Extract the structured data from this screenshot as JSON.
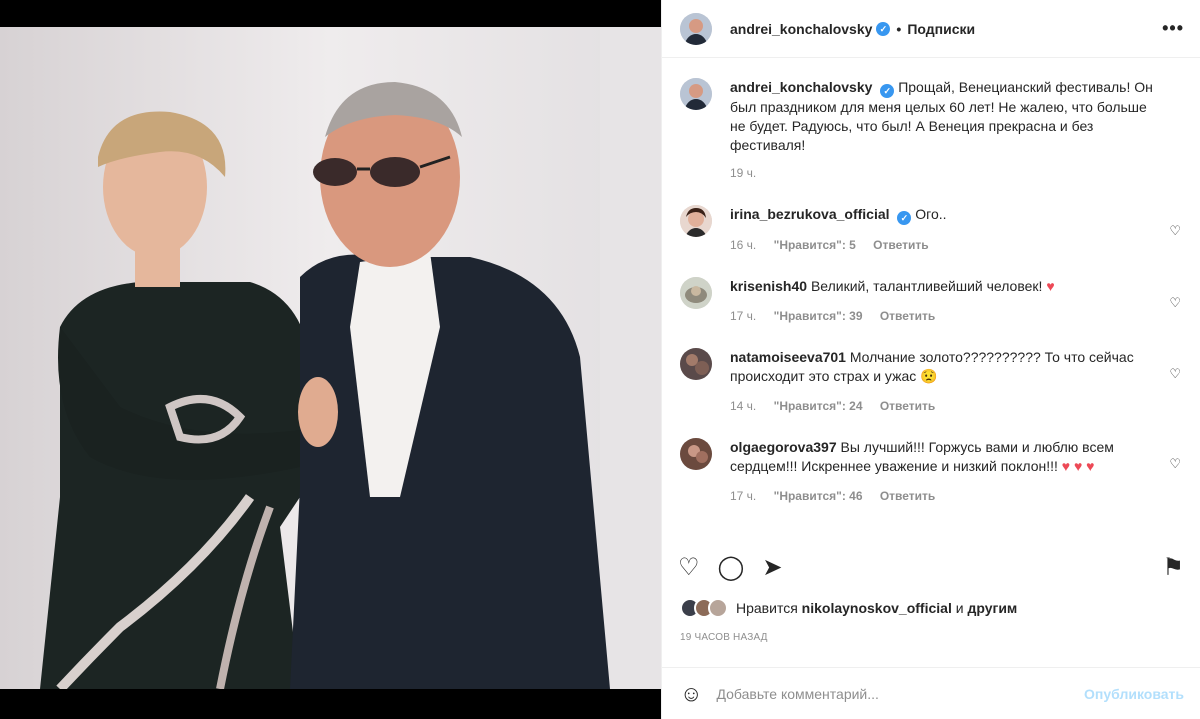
{
  "post": {
    "author": "andrei_konchalovsky",
    "follow_label": "Подписки",
    "dot": "•",
    "more": "•••"
  },
  "caption": {
    "author": "andrei_konchalovsky",
    "text": "Прощай, Венецианский фестиваль! Он был праздником для меня целых 60 лет! Не жалею, что больше не будет. Радуюсь, что был! А Венеция прекрасна и без фестиваля!",
    "time": "19 ч."
  },
  "comments": [
    {
      "user": "irina_bezrukova_official",
      "verified": true,
      "text": "Ого..",
      "emoji": "",
      "time": "16 ч.",
      "likes": "\"Нравится\": 5",
      "reply": "Ответить"
    },
    {
      "user": "krisenish40",
      "verified": false,
      "text": "Великий, талантливейший человек!",
      "emoji": "♥",
      "time": "17 ч.",
      "likes": "\"Нравится\": 39",
      "reply": "Ответить"
    },
    {
      "user": "natamoiseeva701",
      "verified": false,
      "text": "Молчание золото?????????? То что сейчас происходит это страх и ужас",
      "emoji": "😟",
      "time": "14 ч.",
      "likes": "\"Нравится\": 24",
      "reply": "Ответить"
    },
    {
      "user": "olgaegorova397",
      "verified": false,
      "text": "Вы лучший!!! Горжусь вами и люблю всем сердцем!!! Искреннее уважение и низкий поклон!!!",
      "emoji": "♥ ♥ ♥",
      "time": "17 ч.",
      "likes": "\"Нравится\": 46",
      "reply": "Ответить"
    }
  ],
  "likes": {
    "prefix": "Нравится",
    "user": "nikolaynoskov_official",
    "and": "и",
    "others": "другим"
  },
  "timestamp": "19 ЧАСОВ НАЗАД",
  "add_comment": {
    "placeholder": "Добавьте комментарий...",
    "post_label": "Опубликовать"
  },
  "icons": {
    "heart": "♡",
    "comment": "◯",
    "share": "➤",
    "save": "⚑",
    "emoji": "☺",
    "verified": "✓"
  }
}
